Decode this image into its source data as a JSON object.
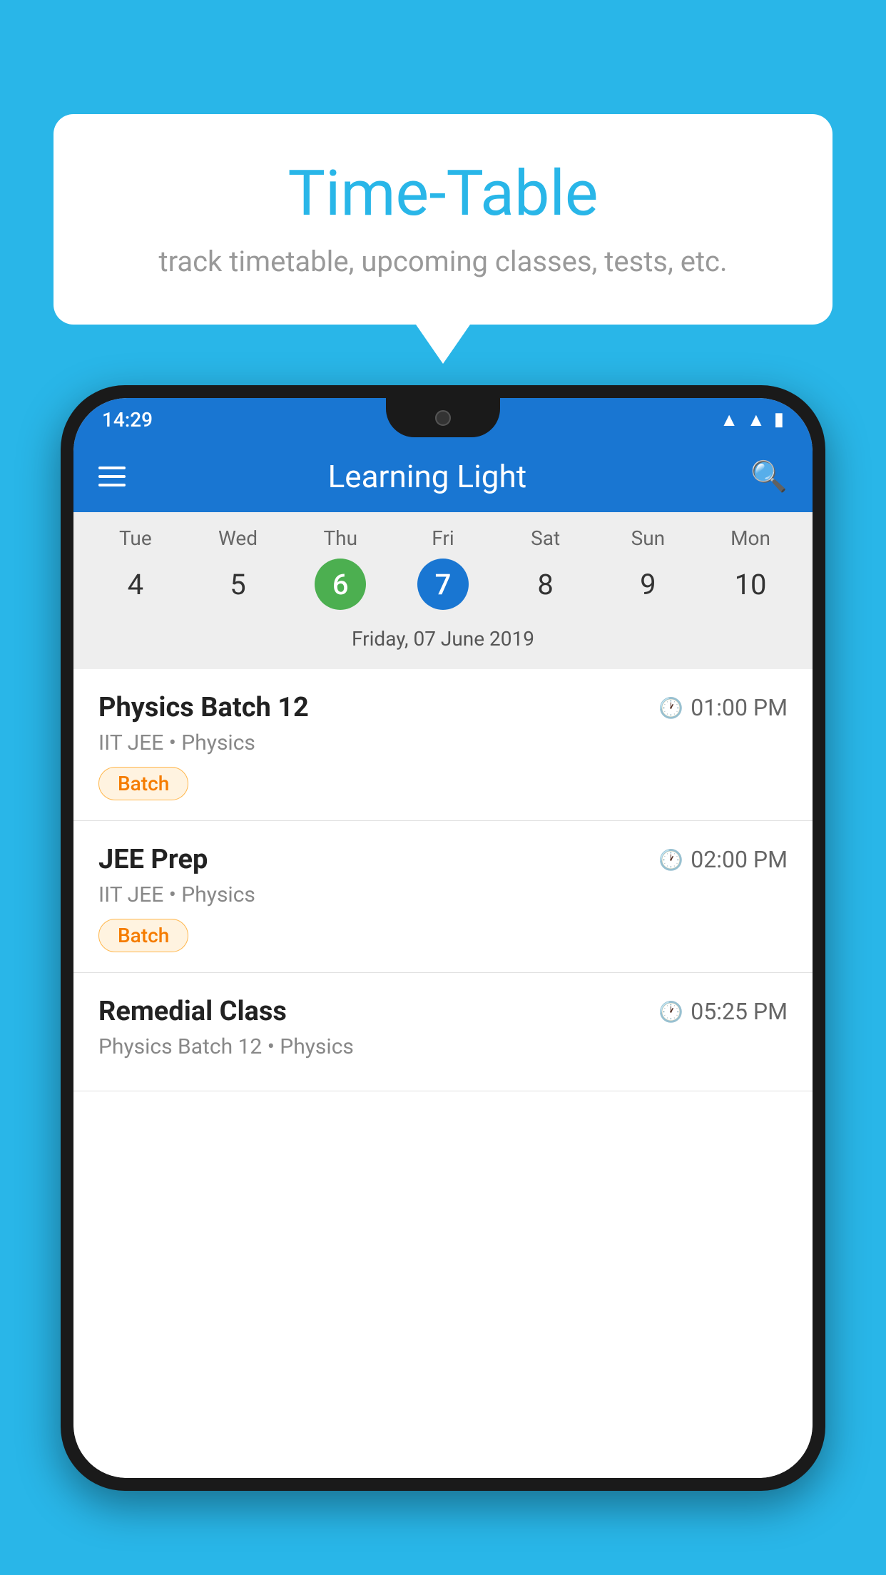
{
  "background_color": "#29B6E8",
  "speech_bubble": {
    "title": "Time-Table",
    "subtitle": "track timetable, upcoming classes, tests, etc."
  },
  "status_bar": {
    "time": "14:29"
  },
  "app_bar": {
    "title": "Learning Light"
  },
  "calendar": {
    "days": [
      {
        "name": "Tue",
        "number": "4",
        "state": "normal"
      },
      {
        "name": "Wed",
        "number": "5",
        "state": "normal"
      },
      {
        "name": "Thu",
        "number": "6",
        "state": "today"
      },
      {
        "name": "Fri",
        "number": "7",
        "state": "selected"
      },
      {
        "name": "Sat",
        "number": "8",
        "state": "normal"
      },
      {
        "name": "Sun",
        "number": "9",
        "state": "normal"
      },
      {
        "name": "Mon",
        "number": "10",
        "state": "normal"
      }
    ],
    "selected_date_label": "Friday, 07 June 2019"
  },
  "schedule": {
    "items": [
      {
        "title": "Physics Batch 12",
        "time": "01:00 PM",
        "sub": "IIT JEE • Physics",
        "badge": "Batch"
      },
      {
        "title": "JEE Prep",
        "time": "02:00 PM",
        "sub": "IIT JEE • Physics",
        "badge": "Batch"
      },
      {
        "title": "Remedial Class",
        "time": "05:25 PM",
        "sub": "Physics Batch 12 • Physics",
        "badge": null
      }
    ]
  },
  "icons": {
    "search": "🔍",
    "clock": "🕐",
    "wifi": "▲",
    "signal": "◀",
    "battery": "▮"
  }
}
